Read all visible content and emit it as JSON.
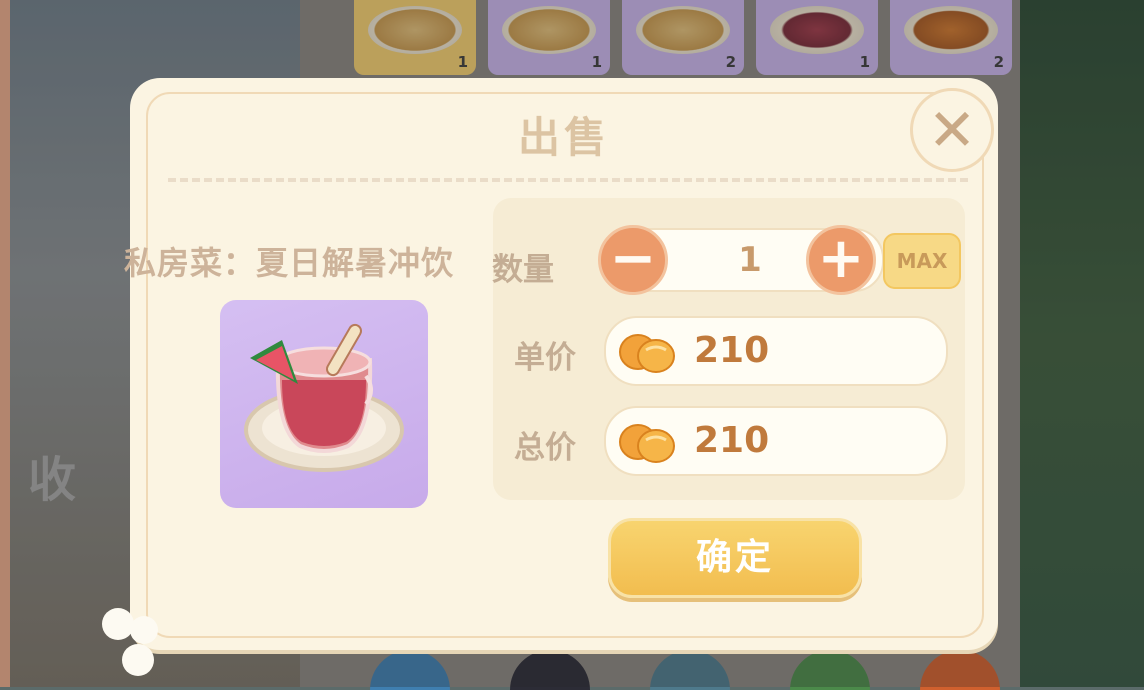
{
  "background": {
    "left_text": "收",
    "dish_counts": [
      "1",
      "1",
      "2",
      "1",
      "2"
    ]
  },
  "dialog": {
    "title": "出售",
    "close_label": "✕",
    "item_name": "私房菜：夏日解暑冲饮",
    "quantity": {
      "label": "数量",
      "value": "1",
      "minus": "−",
      "plus": "+",
      "max": "MAX"
    },
    "unit_price": {
      "label": "单价",
      "value": "210"
    },
    "total_price": {
      "label": "总价",
      "value": "210"
    },
    "confirm": "确定"
  },
  "colors": {
    "accent_orange": "#ec9a6a",
    "confirm_yellow": "#f2bd4f",
    "price_text": "#c07a3c",
    "item_bg": "#d5bff2"
  }
}
